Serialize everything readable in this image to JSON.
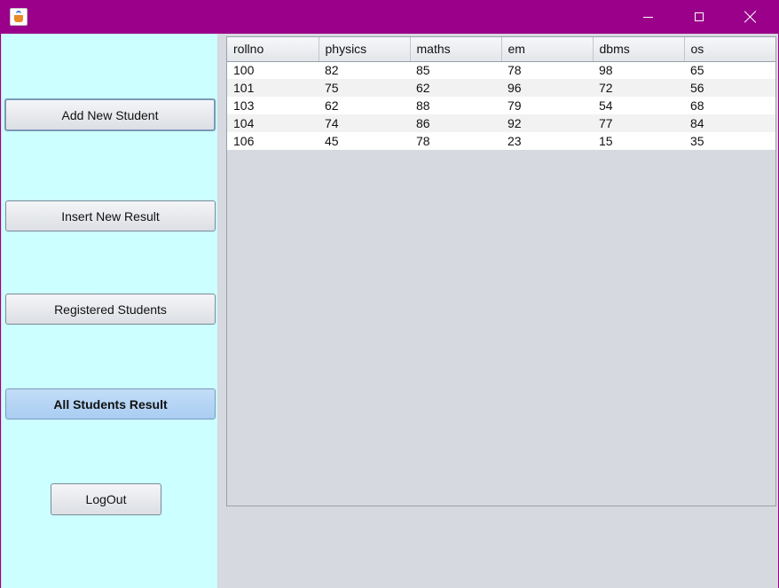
{
  "window": {
    "icon": "java-coffee-cup-icon",
    "controls": [
      "minimize-icon",
      "maximize-icon",
      "close-icon"
    ]
  },
  "sidebar": {
    "add_student": "Add New Student",
    "insert_result": "Insert New Result",
    "registered_students": "Registered Students",
    "all_results": "All Students Result",
    "logout": "LogOut"
  },
  "table": {
    "headers": [
      "rollno",
      "physics",
      "maths",
      "em",
      "dbms",
      "os"
    ],
    "rows": [
      [
        "100",
        "82",
        "85",
        "78",
        "98",
        "65"
      ],
      [
        "101",
        "75",
        "62",
        "96",
        "72",
        "56"
      ],
      [
        "103",
        "62",
        "88",
        "79",
        "54",
        "68"
      ],
      [
        "104",
        "74",
        "86",
        "92",
        "77",
        "84"
      ],
      [
        "106",
        "45",
        "78",
        "23",
        "15",
        "35"
      ]
    ]
  },
  "colors": {
    "titlebar": "#9a0089",
    "sidebar": "#ccffff",
    "active_button": "#b5d5f5"
  }
}
